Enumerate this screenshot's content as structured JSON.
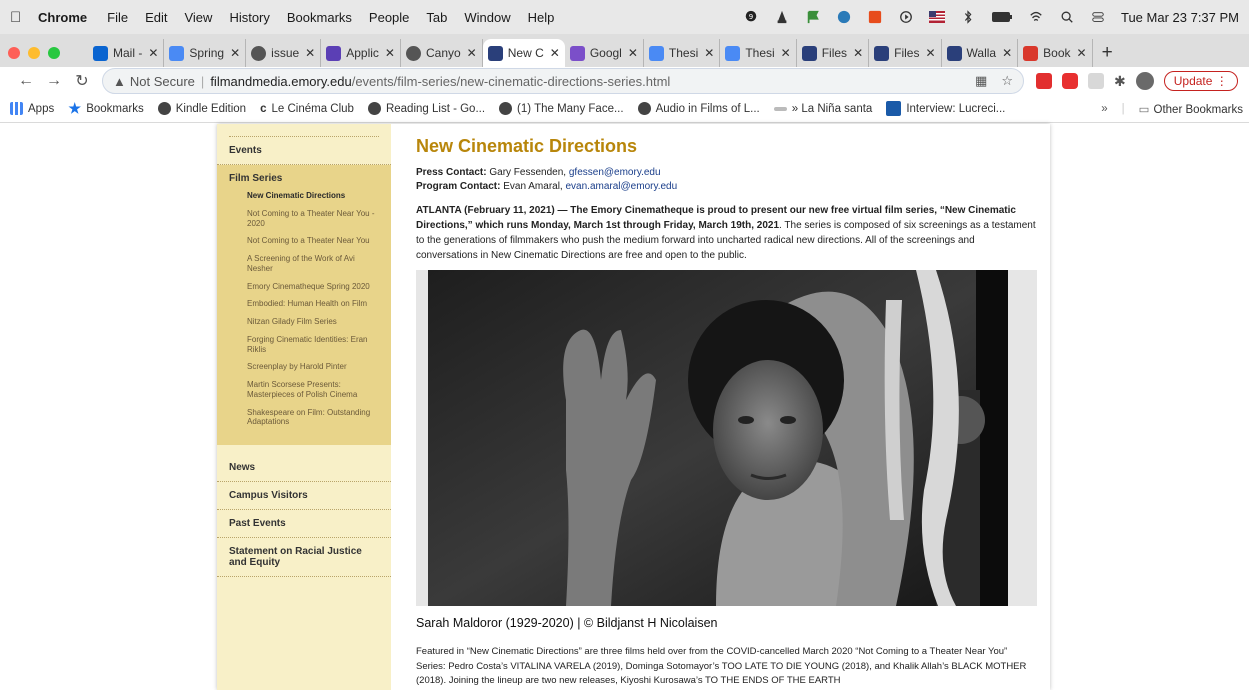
{
  "menubar": {
    "app": "Chrome",
    "items": [
      "File",
      "Edit",
      "View",
      "History",
      "Bookmarks",
      "People",
      "Tab",
      "Window",
      "Help"
    ],
    "clock": "Tue Mar 23  7:37 PM"
  },
  "tabs": [
    {
      "label": "Mail -",
      "color": "#0a64d0"
    },
    {
      "label": "Spring",
      "color": "#4a8af4"
    },
    {
      "label": "issue",
      "color": "#555555"
    },
    {
      "label": "Applic",
      "color": "#5b3fb5"
    },
    {
      "label": "Canyo",
      "color": "#555555"
    },
    {
      "label": "New C",
      "color": "#2a3f7a",
      "active": true
    },
    {
      "label": "Googl",
      "color": "#7b4fc9"
    },
    {
      "label": "Thesi",
      "color": "#4a8af4"
    },
    {
      "label": "Thesi",
      "color": "#4a8af4"
    },
    {
      "label": "Files",
      "color": "#2a3f7a"
    },
    {
      "label": "Files",
      "color": "#2a3f7a"
    },
    {
      "label": "Walla",
      "color": "#2a3f7a"
    },
    {
      "label": "Book",
      "color": "#d9382c"
    }
  ],
  "omnibox": {
    "security": "Not Secure",
    "host": "filmandmedia.emory.edu",
    "path": "/events/film-series/new-cinematic-directions-series.html"
  },
  "update_label": "Update",
  "bookmarks": [
    {
      "label": "Apps",
      "color": "#4285f4"
    },
    {
      "label": "Bookmarks",
      "color": "#1a73e8"
    },
    {
      "label": "Kindle Edition",
      "color": "#444444"
    },
    {
      "label": "Le Cinéma Club",
      "color": "#000000"
    },
    {
      "label": "Reading List - Go...",
      "color": "#444444"
    },
    {
      "label": "(1) The Many Face...",
      "color": "#444444"
    },
    {
      "label": "Audio in Films of L...",
      "color": "#444444"
    },
    {
      "label": "» La Niña santa",
      "color": "#888888"
    },
    {
      "label": "Interview: Lucreci...",
      "color": "#1a5aa8"
    }
  ],
  "other_bookmarks": "Other Bookmarks",
  "sidebar": {
    "events": "Events",
    "film_series": "Film Series",
    "sub_items": [
      {
        "label": "New Cinematic Directions",
        "active": true
      },
      {
        "label": "Not Coming to a Theater Near You - 2020"
      },
      {
        "label": "Not Coming to a Theater Near You"
      },
      {
        "label": "A Screening of the Work of Avi Nesher"
      },
      {
        "label": "Emory Cinematheque Spring 2020"
      },
      {
        "label": "Embodied: Human Health on Film"
      },
      {
        "label": "Nitzan Gilady Film Series"
      },
      {
        "label": "Forging Cinematic Identities: Eran Riklis"
      },
      {
        "label": "Screenplay by Harold Pinter"
      },
      {
        "label": "Martin Scorsese Presents: Masterpieces of Polish Cinema"
      },
      {
        "label": "Shakespeare on Film: Outstanding Adaptations"
      }
    ],
    "news": "News",
    "campus_visitors": "Campus Visitors",
    "past_events": "Past Events",
    "statement": "Statement on Racial Justice and Equity"
  },
  "article": {
    "title": "New Cinematic Directions",
    "press_label": "Press Contact:",
    "press_name": "Gary Fessenden,",
    "press_email": "gfessen@emory.edu",
    "program_label": "Program Contact:",
    "program_name": "Evan Amaral,",
    "program_email": "evan.amaral@emory.edu",
    "intro_bold": "ATLANTA (February 11, 2021) — The Emory Cinematheque is proud to present our new free virtual film series, “New Cinematic Directions,” which runs Monday, March 1st through Friday, March 19th, 2021",
    "intro_rest": ". The series is composed of six screenings as a testament to the generations of filmmakers who push the medium forward into uncharted radical new directions. All of the screenings and conversations in New Cinematic Directions are free and open to the public.",
    "caption": "Sarah Maldoror (1929-2020) | © Bildjanst H Nicolaisen",
    "paragraph": "Featured in “New Cinematic Directions” are three films held over from the COVID-cancelled March 2020 “Not Coming to a Theater Near You” Series: Pedro Costa’s VITALINA VARELA (2019), Dominga Sotomayor’s TOO LATE TO DIE YOUNG (2018), and Khalik Allah’s BLACK MOTHER (2018). Joining the lineup are two new releases, Kiyoshi Kurosawa’s TO THE ENDS OF THE EARTH"
  }
}
